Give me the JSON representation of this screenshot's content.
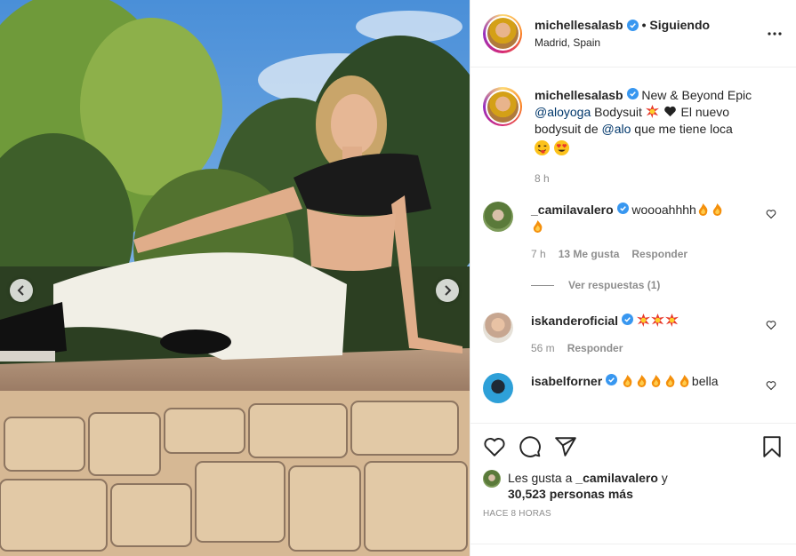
{
  "post": {
    "username": "michellesalasb",
    "following_label": "• Siguiendo",
    "location": "Madrid, Spain"
  },
  "caption": {
    "username": "michellesalasb",
    "text_1": "New & Beyond Epic",
    "mention_1": "@aloyoga",
    "text_2": "Bodysuit",
    "text_3": "El nuevo bodysuit de",
    "mention_2": "@alo",
    "text_4": "que me tiene loca",
    "time": "8 h"
  },
  "comments": [
    {
      "username": "_camilavalero",
      "text": "woooahhhh",
      "time": "7 h",
      "likes": "13 Me gusta",
      "reply": "Responder"
    },
    {
      "username": "iskanderoficial",
      "text": "",
      "time": "56 m",
      "reply": "Responder"
    },
    {
      "username": "isabelforner",
      "text": "bella"
    }
  ],
  "view_replies": "Ver respuestas (1)",
  "likes": {
    "prefix": "Les gusta a",
    "user": "_camilavalero",
    "suffix": "y",
    "count": "30,523 personas más"
  },
  "time_ago": "HACE 8 HORAS",
  "colors": {
    "verified": "#3897f0",
    "mention": "#00376b",
    "muted": "#8e8e8e"
  },
  "icons": [
    "verified-icon",
    "more-icon",
    "heart-icon",
    "comment-icon",
    "share-icon",
    "bookmark-icon",
    "chevron-left-icon",
    "chevron-right-icon"
  ]
}
